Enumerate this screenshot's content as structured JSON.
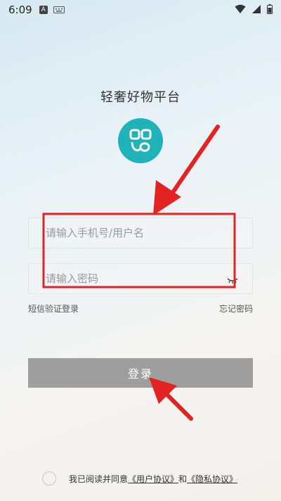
{
  "status_bar": {
    "time": "6:09",
    "app_icon": "A"
  },
  "app_title": "轻奢好物平台",
  "logo_icon": "link-logo-icon",
  "login_form": {
    "username_placeholder": "请输入手机号/用户名",
    "password_placeholder": "请输入密码",
    "sms_login_link": "短信验证登录",
    "forgot_password_link": "忘记密码",
    "login_button": "登录"
  },
  "agreement": {
    "text": "我已阅读并同意",
    "user_agreement": "《用户协议》",
    "and": "和",
    "privacy_agreement": "《隐私协议》"
  },
  "colors": {
    "logo": "#1fb2b8",
    "button": "#9e9e9e",
    "annotation": "#e32222"
  }
}
